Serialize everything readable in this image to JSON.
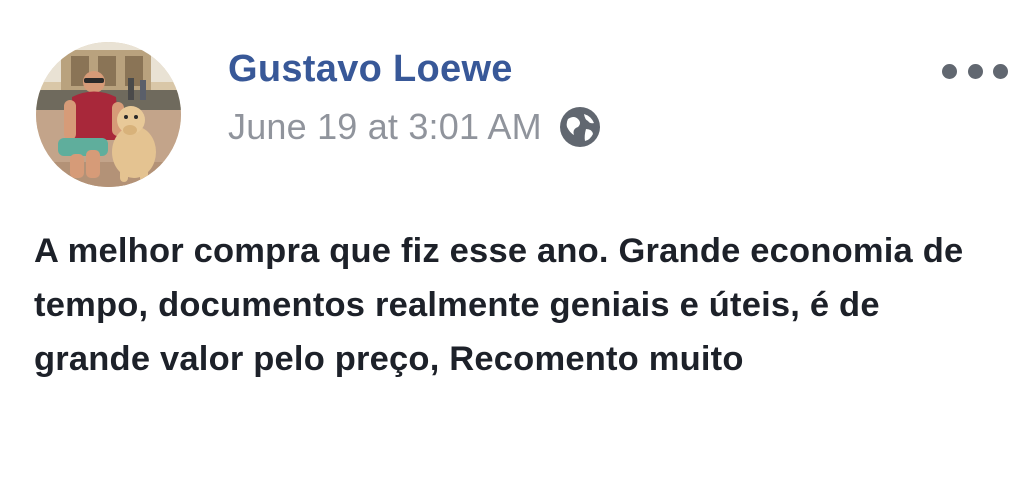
{
  "post": {
    "author": {
      "name": "Gustavo Loewe",
      "avatar": "profile-photo"
    },
    "timestamp": "June 19 at 3:01 AM",
    "audience_icon": "globe-icon",
    "more_icon": "more-options-icon",
    "text": "A melhor compra que fiz esse ano. Grande economia de tempo, documentos realmente geniais e úteis, é de grande valor pelo preço, Recomento muito"
  },
  "colors": {
    "author_name": "#385898",
    "timestamp": "#90949c",
    "body_text": "#1d2129",
    "icon": "#616770"
  }
}
